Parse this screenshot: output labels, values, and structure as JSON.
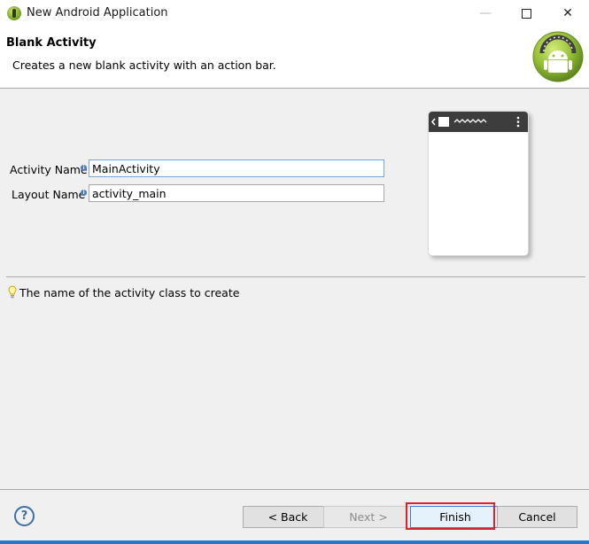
{
  "window": {
    "title": "New Android Application",
    "controls": {
      "minimize": "—",
      "maximize": "□",
      "close": "✕"
    }
  },
  "header": {
    "title": "Blank Activity",
    "description": "Creates a new blank activity with an action bar."
  },
  "form": {
    "activity_name_label": "Activity Name",
    "activity_name_value": "MainActivity",
    "layout_name_label": "Layout Name",
    "layout_name_value": "activity_main"
  },
  "hint": "The name of the activity class to create",
  "buttons": {
    "help": "?",
    "back": "< Back",
    "next": "Next >",
    "finish": "Finish",
    "cancel": "Cancel"
  },
  "colors": {
    "accent": "#1f7ad1",
    "highlight": "#e0202a",
    "android_green": "#8fbf2a"
  },
  "icons": [
    "android-eclipse-app-icon",
    "android-logo-icon",
    "info-icon",
    "lightbulb-icon",
    "help-icon"
  ]
}
